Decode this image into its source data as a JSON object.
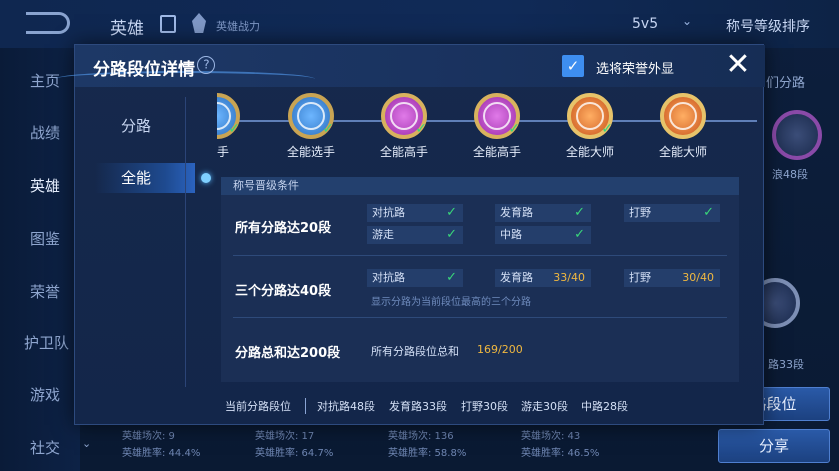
{
  "background": {
    "title": "英雄",
    "power_text": "英雄战力",
    "mode": "5v5",
    "sort": "称号等级排序",
    "sidebar": [
      "主页",
      "战绩",
      "英雄",
      "图鉴",
      "荣誉",
      "护卫队",
      "游戏",
      "社交"
    ],
    "right_texts": [
      "们分路",
      "浪48段",
      "路33段"
    ],
    "right_buttons": [
      "路段位",
      "分享"
    ],
    "stats": [
      {
        "l1": "英雄场次: 9",
        "l2": "英雄胜率: 44.4%"
      },
      {
        "l1": "英雄场次: 17",
        "l2": "英雄胜率: 64.7%"
      },
      {
        "l1": "英雄场次: 136",
        "l2": "英雄胜率: 58.8%"
      },
      {
        "l1": "英雄场次: 43",
        "l2": "英雄胜率: 46.5%"
      }
    ]
  },
  "modal": {
    "title": "分路段位详情",
    "help": "?",
    "checkbox_label": "选将荣誉外显",
    "checkbox_checked": true,
    "close": "✕",
    "tabs": [
      "分路",
      "全能"
    ],
    "active_tab": "全能",
    "medals": [
      {
        "name": "选手",
        "color": "#3d8bd6",
        "checked": true
      },
      {
        "name": "全能选手",
        "color": "#2f7fc9",
        "checked": true
      },
      {
        "name": "全能高手",
        "color": "#b23bc7",
        "checked": true
      },
      {
        "name": "全能高手",
        "color": "#b23bc7",
        "checked": true
      },
      {
        "name": "全能大师",
        "color": "#e0782f",
        "checked": true
      },
      {
        "name": "全能大师",
        "color": "#e0782f",
        "checked": false
      }
    ],
    "panel_head": "称号晋级条件",
    "conditions": [
      {
        "title": "所有分路达20段",
        "chips": [
          {
            "label": "对抗路",
            "done": true
          },
          {
            "label": "发育路",
            "done": true
          },
          {
            "label": "打野",
            "done": true
          },
          {
            "label": "游走",
            "done": true
          },
          {
            "label": "中路",
            "done": true
          }
        ]
      },
      {
        "title": "三个分路达40段",
        "chips": [
          {
            "label": "对抗路",
            "done": true
          },
          {
            "label": "发育路",
            "progress": "33/40"
          },
          {
            "label": "打野",
            "progress": "30/40"
          }
        ],
        "note": "显示分路为当前段位最高的三个分路"
      },
      {
        "title": "分路总和达200段",
        "sum_label": "所有分路段位总和",
        "sum_value": "169/200"
      }
    ],
    "footer": {
      "label": "当前分路段位",
      "items": [
        "对抗路48段",
        "发育路33段",
        "打野30段",
        "游走30段",
        "中路28段"
      ]
    }
  }
}
